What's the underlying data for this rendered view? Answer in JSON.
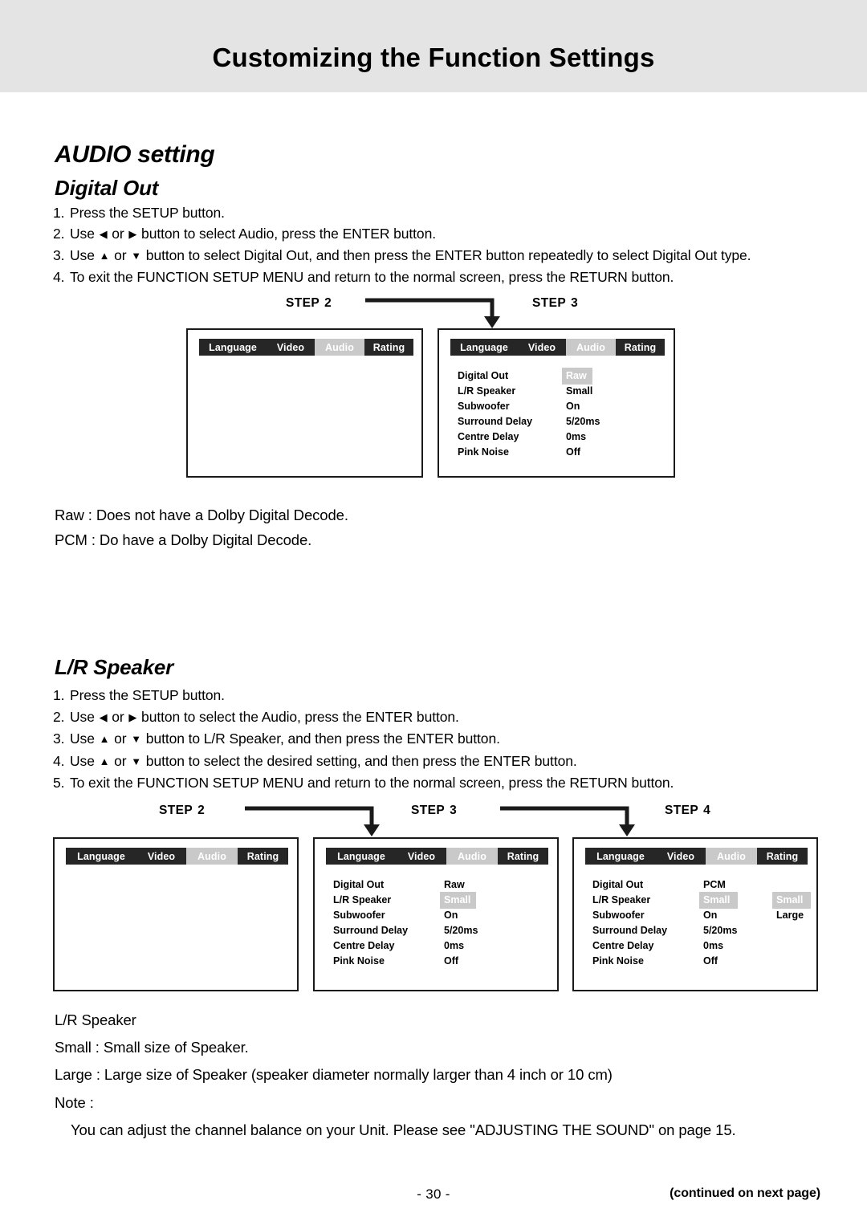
{
  "header": {
    "title": "Customizing the Function Settings"
  },
  "sections": {
    "audio_setting_title": "AUDIO setting",
    "digital_out_title": "Digital Out",
    "lr_speaker_title": "L/R Speaker"
  },
  "digital_out_steps": [
    {
      "num": "1.",
      "text": "Press the SETUP button."
    },
    {
      "num": "2.",
      "pre": "Use ",
      "left_arrow": "◀",
      "mid": " or ",
      "right_arrow": "▶",
      "post": " button to select Audio, press the ENTER button."
    },
    {
      "num": "3.",
      "pre": "Use ",
      "up_arrow": "▲",
      "mid": " or ",
      "down_arrow": "▼",
      "post": " button to select Digital Out, and then press the ENTER button repeatedly to select Digital Out type."
    },
    {
      "num": "4.",
      "text": "To exit the FUNCTION SETUP MENU and return to the normal screen, press the RETURN button."
    }
  ],
  "lr_speaker_steps": [
    {
      "num": "1.",
      "text": "Press the SETUP button."
    },
    {
      "num": "2.",
      "pre": "Use ",
      "left_arrow": "◀",
      "mid": " or ",
      "right_arrow": "▶",
      "post": " button to select the Audio, press the ENTER button."
    },
    {
      "num": "3.",
      "pre": "Use ",
      "up_arrow": "▲",
      "mid": " or ",
      "down_arrow": "▼",
      "post": " button to L/R Speaker, and then press the ENTER button."
    },
    {
      "num": "4.",
      "pre": "Use ",
      "up_arrow": "▲",
      "mid": " or ",
      "down_arrow": "▼",
      "post": " button to select the desired setting, and then press the ENTER button."
    },
    {
      "num": "5.",
      "text": "To exit the FUNCTION SETUP MENU and return to the normal screen, press the RETURN button."
    }
  ],
  "step_labels": {
    "row1": [
      {
        "word": "STEP",
        "number": "2"
      },
      {
        "word": "STEP",
        "number": "3"
      }
    ],
    "row2": [
      {
        "word": "STEP",
        "number": "2"
      },
      {
        "word": "STEP",
        "number": "3"
      },
      {
        "word": "STEP",
        "number": "4"
      }
    ]
  },
  "tabs": [
    "Language",
    "Video",
    "Audio",
    "Rating"
  ],
  "active_tab": "Audio",
  "menu_labels": [
    "Digital Out",
    "L/R Speaker",
    "Subwoofer",
    "Surround Delay",
    "Centre Delay",
    "Pink Noise"
  ],
  "screens": {
    "row1_step2": {
      "rows": []
    },
    "row1_step3": {
      "rows": [
        {
          "label": "Digital Out",
          "value": "Raw",
          "highlighted": true
        },
        {
          "label": "L/R Speaker",
          "value": "Small",
          "highlighted": false
        },
        {
          "label": "Subwoofer",
          "value": "On",
          "highlighted": false
        },
        {
          "label": "Surround Delay",
          "value": "5/20ms",
          "highlighted": false
        },
        {
          "label": "Centre Delay",
          "value": "0ms",
          "highlighted": false
        },
        {
          "label": "Pink Noise",
          "value": "Off",
          "highlighted": false
        }
      ]
    },
    "row2_step2": {
      "rows": []
    },
    "row2_step3": {
      "rows": [
        {
          "label": "Digital Out",
          "value": "Raw",
          "highlighted": false
        },
        {
          "label": "L/R Speaker",
          "value": "Small",
          "highlighted": true
        },
        {
          "label": "Subwoofer",
          "value": "On",
          "highlighted": false
        },
        {
          "label": "Surround Delay",
          "value": "5/20ms",
          "highlighted": false
        },
        {
          "label": "Centre Delay",
          "value": "0ms",
          "highlighted": false
        },
        {
          "label": "Pink Noise",
          "value": "Off",
          "highlighted": false
        }
      ]
    },
    "row2_step4": {
      "rows": [
        {
          "label": "Digital Out",
          "value": "PCM",
          "highlighted": false,
          "option": ""
        },
        {
          "label": "L/R Speaker",
          "value": "Small",
          "highlighted": true,
          "option": "Small",
          "option_highlighted": true
        },
        {
          "label": "Subwoofer",
          "value": "On",
          "highlighted": false,
          "option": "Large",
          "option_highlighted": false
        },
        {
          "label": "Surround Delay",
          "value": "5/20ms",
          "highlighted": false,
          "option": ""
        },
        {
          "label": "Centre Delay",
          "value": "0ms",
          "highlighted": false,
          "option": ""
        },
        {
          "label": "Pink Noise",
          "value": "Off",
          "highlighted": false,
          "option": ""
        }
      ]
    }
  },
  "descriptions": {
    "raw": "Raw : Does not have a Dolby Digital Decode.",
    "pcm": "PCM : Do have a Dolby Digital Decode.",
    "legend_title": "L/R Speaker",
    "legend_small": "Small :  Small size of Speaker.",
    "legend_large": "Large :  Large size of Speaker (speaker diameter normally larger than 4 inch or 10 cm)",
    "note_label": "Note :",
    "note_text": "You can adjust the channel balance on your Unit. Please see \"ADJUSTING THE SOUND\" on page 15."
  },
  "footer": {
    "page_number": "- 30 -",
    "continued": "(continued on next page)"
  },
  "colors": {
    "header_band": "#e4e4e4",
    "tab_dark": "#262626",
    "tab_active": "#c9c9c9",
    "highlight": "#c9c9c9",
    "border": "#1a1a1a"
  }
}
